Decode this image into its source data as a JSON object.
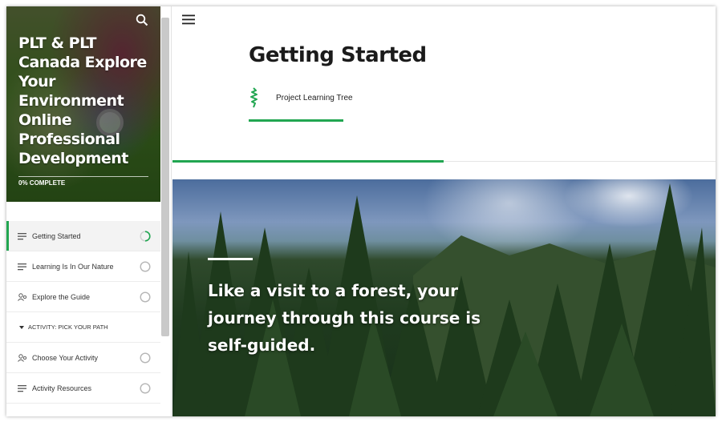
{
  "sidebar": {
    "course_title": "PLT & PLT Canada Explore Your Environment Online Professional Development",
    "progress_label": "0% COMPLETE",
    "items": [
      {
        "label": "Getting Started",
        "icon": "lesson-lines-icon",
        "status": "in-progress"
      },
      {
        "label": "Learning Is In Our Nature",
        "icon": "lesson-lines-icon",
        "status": "not-started"
      },
      {
        "label": "Explore the Guide",
        "icon": "people-icon",
        "status": "not-started"
      }
    ],
    "section": {
      "label": "ACTIVITY: PICK YOUR PATH",
      "icon": "caret-down-icon"
    },
    "section_items": [
      {
        "label": "Choose Your Activity",
        "icon": "people-icon",
        "status": "not-started"
      },
      {
        "label": "Activity Resources",
        "icon": "lesson-lines-icon",
        "status": "not-started"
      }
    ]
  },
  "main": {
    "menu_icon": "hamburger-icon",
    "lesson_title": "Getting Started",
    "author": "Project Learning Tree",
    "author_icon": "tree-icon",
    "quote": "Like a visit to a forest, your journey through this course is self-guided."
  },
  "colors": {
    "accent": "#21a651",
    "text": "#1b1b1b"
  }
}
